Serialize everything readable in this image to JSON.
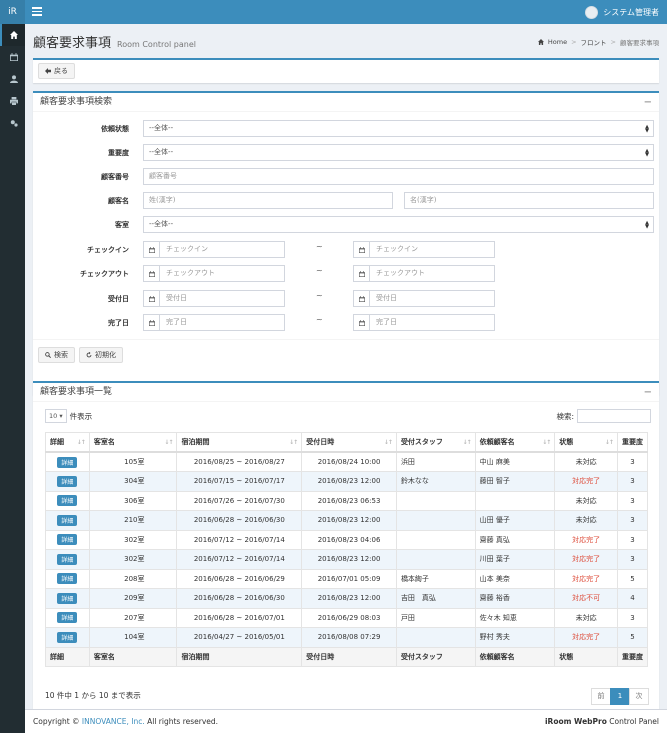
{
  "app": {
    "logo": "iR",
    "user_name": "システム管理者"
  },
  "header": {
    "title": "顧客要求事項",
    "subtitle": "Room Control panel"
  },
  "breadcrumb": {
    "home": "Home",
    "front": "フロント",
    "current": "顧客要求事項"
  },
  "back_button": "戻る",
  "search": {
    "title": "顧客要求事項検索",
    "collapse": "−",
    "labels": {
      "status": "依頼状態",
      "priority": "重要度",
      "customer_no": "顧客番号",
      "customer_name": "顧客名",
      "room": "客室",
      "checkin": "チェックイン",
      "checkout": "チェックアウト",
      "received": "受付日",
      "completed": "完了日"
    },
    "select_all": "--全体--",
    "placeholders": {
      "customer_no": "顧客番号",
      "last_name": "姓(漢字)",
      "first_name": "名(漢字)",
      "checkin": "チェックイン",
      "checkout": "チェックアウト",
      "received": "受付日",
      "completed": "完了日"
    },
    "tilde": "~",
    "search_button": "検索",
    "reset_button": "初期化"
  },
  "list": {
    "title": "顧客要求事項一覧",
    "collapse": "−",
    "page_size": "10",
    "page_size_suffix": "件表示",
    "search_label": "検索:",
    "columns": [
      "詳細",
      "客室名",
      "宿泊期間",
      "受付日時",
      "受付スタッフ",
      "依頼顧客名",
      "状態",
      "重要度"
    ],
    "detail_label": "詳細",
    "rows": [
      [
        "105室",
        "2016/08/25 ~ 2016/08/27",
        "2016/08/24 10:00",
        "浜田",
        "中山 麻美",
        "未対応",
        "3"
      ],
      [
        "304室",
        "2016/07/15 ~ 2016/07/17",
        "2016/08/23 12:00",
        "鈴木なな",
        "藤田 智子",
        "対応完了",
        "3"
      ],
      [
        "306室",
        "2016/07/26 ~ 2016/07/30",
        "2016/08/23 06:53",
        "",
        "",
        "未対応",
        "3"
      ],
      [
        "210室",
        "2016/06/28 ~ 2016/06/30",
        "2016/08/23 12:00",
        "",
        "山田 優子",
        "未対応",
        "3"
      ],
      [
        "302室",
        "2016/07/12 ~ 2016/07/14",
        "2016/08/23 04:06",
        "",
        "齋藤 真弘",
        "対応完了",
        "3"
      ],
      [
        "302室",
        "2016/07/12 ~ 2016/07/14",
        "2016/08/23 12:00",
        "",
        "川田 葉子",
        "対応完了",
        "3"
      ],
      [
        "208室",
        "2016/06/28 ~ 2016/06/29",
        "2016/07/01 05:09",
        "橋本絢子",
        "山本 美奈",
        "対応完了",
        "5"
      ],
      [
        "209室",
        "2016/06/28 ~ 2016/06/30",
        "2016/08/23 12:00",
        "吉田　真弘",
        "齋藤 裕香",
        "対応不可",
        "4"
      ],
      [
        "207室",
        "2016/06/28 ~ 2016/07/01",
        "2016/06/29 08:03",
        "戸田",
        "佐々木 知恵",
        "未対応",
        "3"
      ],
      [
        "104室",
        "2016/04/27 ~ 2016/05/01",
        "2016/08/08 07:29",
        "",
        "野村 秀夫",
        "対応完了",
        "5"
      ]
    ],
    "info": "10 件中 1 から 10 まで表示",
    "pager": {
      "prev": "前",
      "page": "1",
      "next": "次"
    }
  },
  "footer": {
    "prefix": "Copyright © ",
    "company": "INNOVANCE, Inc.",
    "suffix": " All rights reserved.",
    "product_bold": "iRoom WebPro",
    "product_rest": " Control Panel"
  },
  "colors": {
    "primary": "#3c8dbc",
    "sidebar": "#222d32",
    "danger": "#dd4b39"
  }
}
